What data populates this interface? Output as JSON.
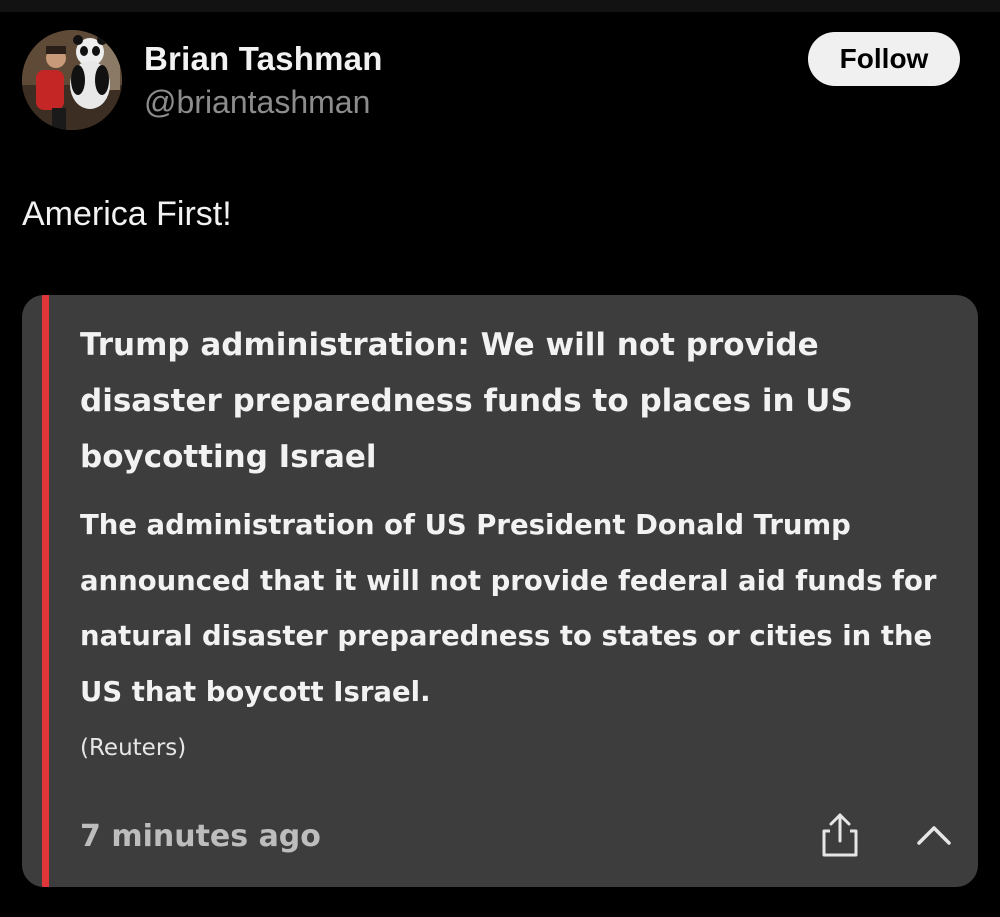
{
  "author": {
    "name": "Brian Tashman",
    "handle": "@briantashman"
  },
  "follow_label": "Follow",
  "post_text": "America First!",
  "embed": {
    "headline": "Trump administration: We will not provide disaster preparedness funds to places in US boycotting Israel",
    "body": "The administration of US President Donald Trump announced that it will not provide federal aid funds for natural disaster preparedness to states or cities in the US that boycott Israel.",
    "source": "(Reuters)",
    "time": "7 minutes ago",
    "accent_color": "#e0363a"
  },
  "icons": {
    "share": "share-icon",
    "collapse": "chevron-up-icon"
  }
}
